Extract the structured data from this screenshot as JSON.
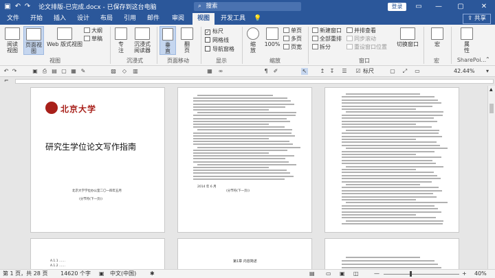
{
  "window": {
    "title": "论文排版-已完成.docx - 已保存到这台电脑",
    "search_placeholder": "搜索",
    "login_label": "登录",
    "accent": "#2b579a"
  },
  "tabs": [
    {
      "label": "文件",
      "active": false
    },
    {
      "label": "开始",
      "active": false
    },
    {
      "label": "插入",
      "active": false
    },
    {
      "label": "设计",
      "active": false
    },
    {
      "label": "布局",
      "active": false
    },
    {
      "label": "引用",
      "active": false
    },
    {
      "label": "邮件",
      "active": false
    },
    {
      "label": "审阅",
      "active": false
    },
    {
      "label": "视图",
      "active": true
    },
    {
      "label": "开发工具",
      "active": false
    }
  ],
  "share_label": "共享",
  "ribbon": {
    "views": {
      "read_mode": "阅读\n视图",
      "page_view": "页面视图",
      "web_layout": "Web 版式视图",
      "outline": "大纲",
      "draft": "草稿",
      "group": "视图"
    },
    "immersive": {
      "focus": "专\n注",
      "reader": "沉浸式\n阅读器",
      "group": "沉浸式"
    },
    "page_movement": {
      "vertical": "垂\n直",
      "side": "翻\n页",
      "group": "页面移动"
    },
    "show": {
      "ruler": "标尺",
      "gridlines": "网格线",
      "nav_pane": "导航窗格",
      "ruler_checked": "✓",
      "group": "显示"
    },
    "zoom": {
      "zoom": "缩\n放",
      "hundred": "100%",
      "one_page": "单页",
      "multi_page": "多页",
      "page_width": "页宽",
      "group": "缩放"
    },
    "window": {
      "new_window": "新建窗口",
      "arrange_all": "全部重排",
      "split": "拆分",
      "side_by_side": "并排查看",
      "sync_scroll": "同步滚动",
      "reset_pos": "重设窗口位置",
      "switch": "切换窗口",
      "group": "窗口"
    },
    "macros": {
      "macro": "宏",
      "group": "宏"
    },
    "properties": {
      "prop": "属\n性",
      "group": "SharePoi..."
    }
  },
  "qat": {
    "ruler_label": "标尺",
    "zoom_value": "42.44%"
  },
  "pages": {
    "cover": {
      "school": "北京大学",
      "title": "研究生学位论文写作指南",
      "office": "北京大学学位办公室二〇一四年五月",
      "footer": "(分节符(下一页))"
    },
    "page2": {
      "date": "2014 年 6 月",
      "section_break": "(分节符(下一页))"
    },
    "page3": {
      "heading": "第1章  内容简述"
    },
    "page_bottom": {
      "toc_row_a": "A.1.1  ……",
      "toc_row_b": "A.1.2  ……"
    }
  },
  "status": {
    "page": "第 1 页，共 28 页",
    "words": "14620 个字",
    "language": "中文(中国)",
    "zoom": "40%"
  }
}
